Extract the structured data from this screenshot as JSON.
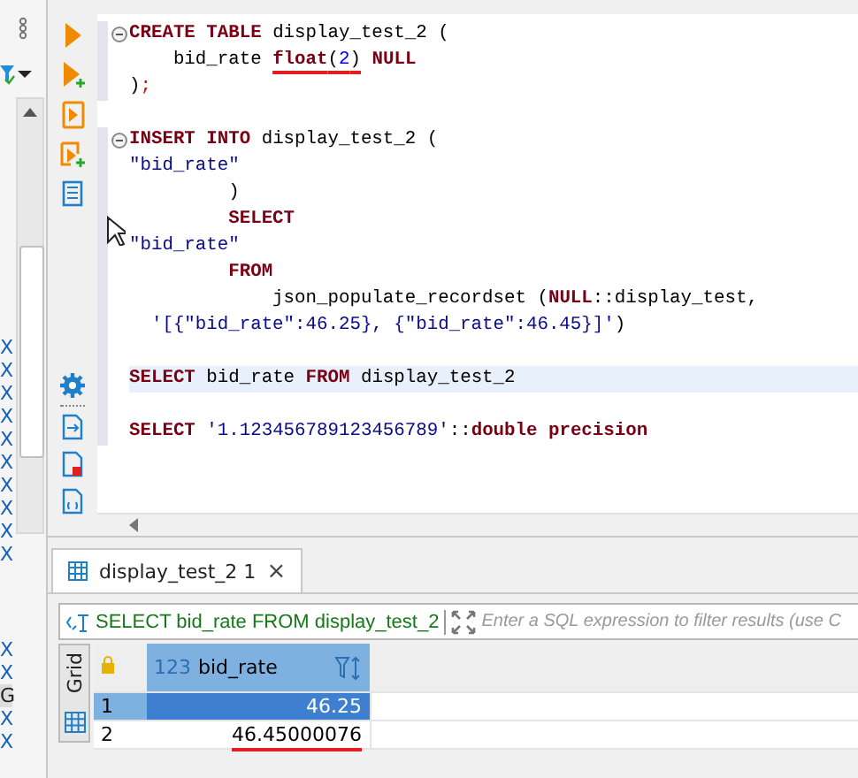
{
  "left_panel": {
    "items": [
      {
        "text": "X",
        "selected": false
      },
      {
        "text": "X",
        "selected": false
      },
      {
        "text": "X",
        "selected": false
      },
      {
        "text": "X",
        "selected": false
      },
      {
        "text": "X",
        "selected": false
      },
      {
        "text": "X",
        "selected": false
      },
      {
        "text": "X",
        "selected": false
      },
      {
        "text": "X",
        "selected": false
      },
      {
        "text": "X",
        "selected": false
      },
      {
        "text": "X",
        "selected": false
      },
      {
        "text": "X",
        "selected": false
      },
      {
        "text": "X",
        "selected": false
      },
      {
        "text": "G",
        "selected": true
      },
      {
        "text": "X",
        "selected": false
      },
      {
        "text": "X",
        "selected": false
      }
    ]
  },
  "editor": {
    "sections": [
      {
        "marked": true,
        "lines": [
          {
            "kind": "code",
            "fold": true,
            "current": false,
            "tokens": [
              {
                "text": "CREATE TABLE",
                "kind": "keyword"
              },
              {
                "text": " display_test_2 (",
                "kind": "plain"
              }
            ]
          },
          {
            "kind": "code",
            "fold": false,
            "current": false,
            "tokens": [
              {
                "text": "    bid_rate ",
                "kind": "plain"
              },
              {
                "text": "float",
                "kind": "keyword",
                "underlined": true
              },
              {
                "text": "(",
                "kind": "plain",
                "underlined": true
              },
              {
                "text": "2",
                "kind": "number",
                "underlined": true
              },
              {
                "text": ")",
                "kind": "plain",
                "underlined": true
              },
              {
                "text": " NULL",
                "kind": "keyword"
              }
            ]
          },
          {
            "kind": "code",
            "fold": false,
            "current": false,
            "tokens": [
              {
                "text": ")",
                "kind": "plain"
              },
              {
                "text": ";",
                "kind": "semicolon"
              }
            ]
          }
        ]
      },
      {
        "marked": false,
        "lines": [
          {
            "kind": "blank"
          }
        ]
      },
      {
        "marked": true,
        "lines": [
          {
            "kind": "code",
            "fold": true,
            "current": false,
            "tokens": [
              {
                "text": "INSERT INTO",
                "kind": "keyword"
              },
              {
                "text": " display_test_2 (",
                "kind": "plain"
              }
            ]
          },
          {
            "kind": "code",
            "fold": false,
            "current": false,
            "tokens": [
              {
                "text": "\"bid_rate\"",
                "kind": "string"
              }
            ]
          },
          {
            "kind": "code",
            "fold": false,
            "current": false,
            "tokens": [
              {
                "text": "         )",
                "kind": "plain"
              }
            ]
          },
          {
            "kind": "code",
            "fold": false,
            "current": false,
            "tokens": [
              {
                "text": "         SELECT",
                "kind": "keyword"
              }
            ]
          },
          {
            "kind": "code",
            "fold": false,
            "current": false,
            "tokens": [
              {
                "text": "\"bid_rate\"",
                "kind": "string"
              }
            ]
          },
          {
            "kind": "code",
            "fold": false,
            "current": false,
            "tokens": [
              {
                "text": "         FROM",
                "kind": "keyword"
              }
            ]
          },
          {
            "kind": "code",
            "fold": false,
            "current": false,
            "tokens": [
              {
                "text": "             json_populate_recordset (",
                "kind": "plain"
              },
              {
                "text": "NULL",
                "kind": "keyword"
              },
              {
                "text": "::display_test,",
                "kind": "plain"
              }
            ]
          },
          {
            "kind": "code",
            "fold": false,
            "current": false,
            "tokens": [
              {
                "text": "  '[{\"bid_rate\":46.25}, {\"bid_rate\":46.45}]'",
                "kind": "string"
              },
              {
                "text": ")",
                "kind": "plain"
              }
            ]
          },
          {
            "kind": "blank"
          },
          {
            "kind": "code",
            "fold": false,
            "current": true,
            "tokens": [
              {
                "text": "SELECT",
                "kind": "keyword"
              },
              {
                "text": " bid_rate ",
                "kind": "plain"
              },
              {
                "text": "FROM",
                "kind": "keyword"
              },
              {
                "text": " display_test_2",
                "kind": "plain"
              }
            ]
          },
          {
            "kind": "blank"
          },
          {
            "kind": "code",
            "fold": false,
            "current": false,
            "tokens": [
              {
                "text": "SELECT",
                "kind": "keyword"
              },
              {
                "text": " '1.123456789123456789'",
                "kind": "string"
              },
              {
                "text": "::",
                "kind": "plain"
              },
              {
                "text": "double precision",
                "kind": "keyword"
              }
            ]
          }
        ]
      }
    ]
  },
  "results": {
    "tab": {
      "label": "display_test_2 1",
      "close": "×",
      "selected": true
    },
    "filter": {
      "query": "SELECT bid_rate FROM display_test_2",
      "placeholder": "Enter a SQL expression to filter results (use C"
    },
    "view_tab": "Grid",
    "columns": [
      {
        "type": "123",
        "name": "bid_rate",
        "selected": true
      }
    ],
    "rows": [
      {
        "number": "1",
        "value": "46.25",
        "selected": true,
        "underlined": false
      },
      {
        "number": "2",
        "value": "46.45000076",
        "selected": false,
        "underlined": true
      }
    ]
  }
}
